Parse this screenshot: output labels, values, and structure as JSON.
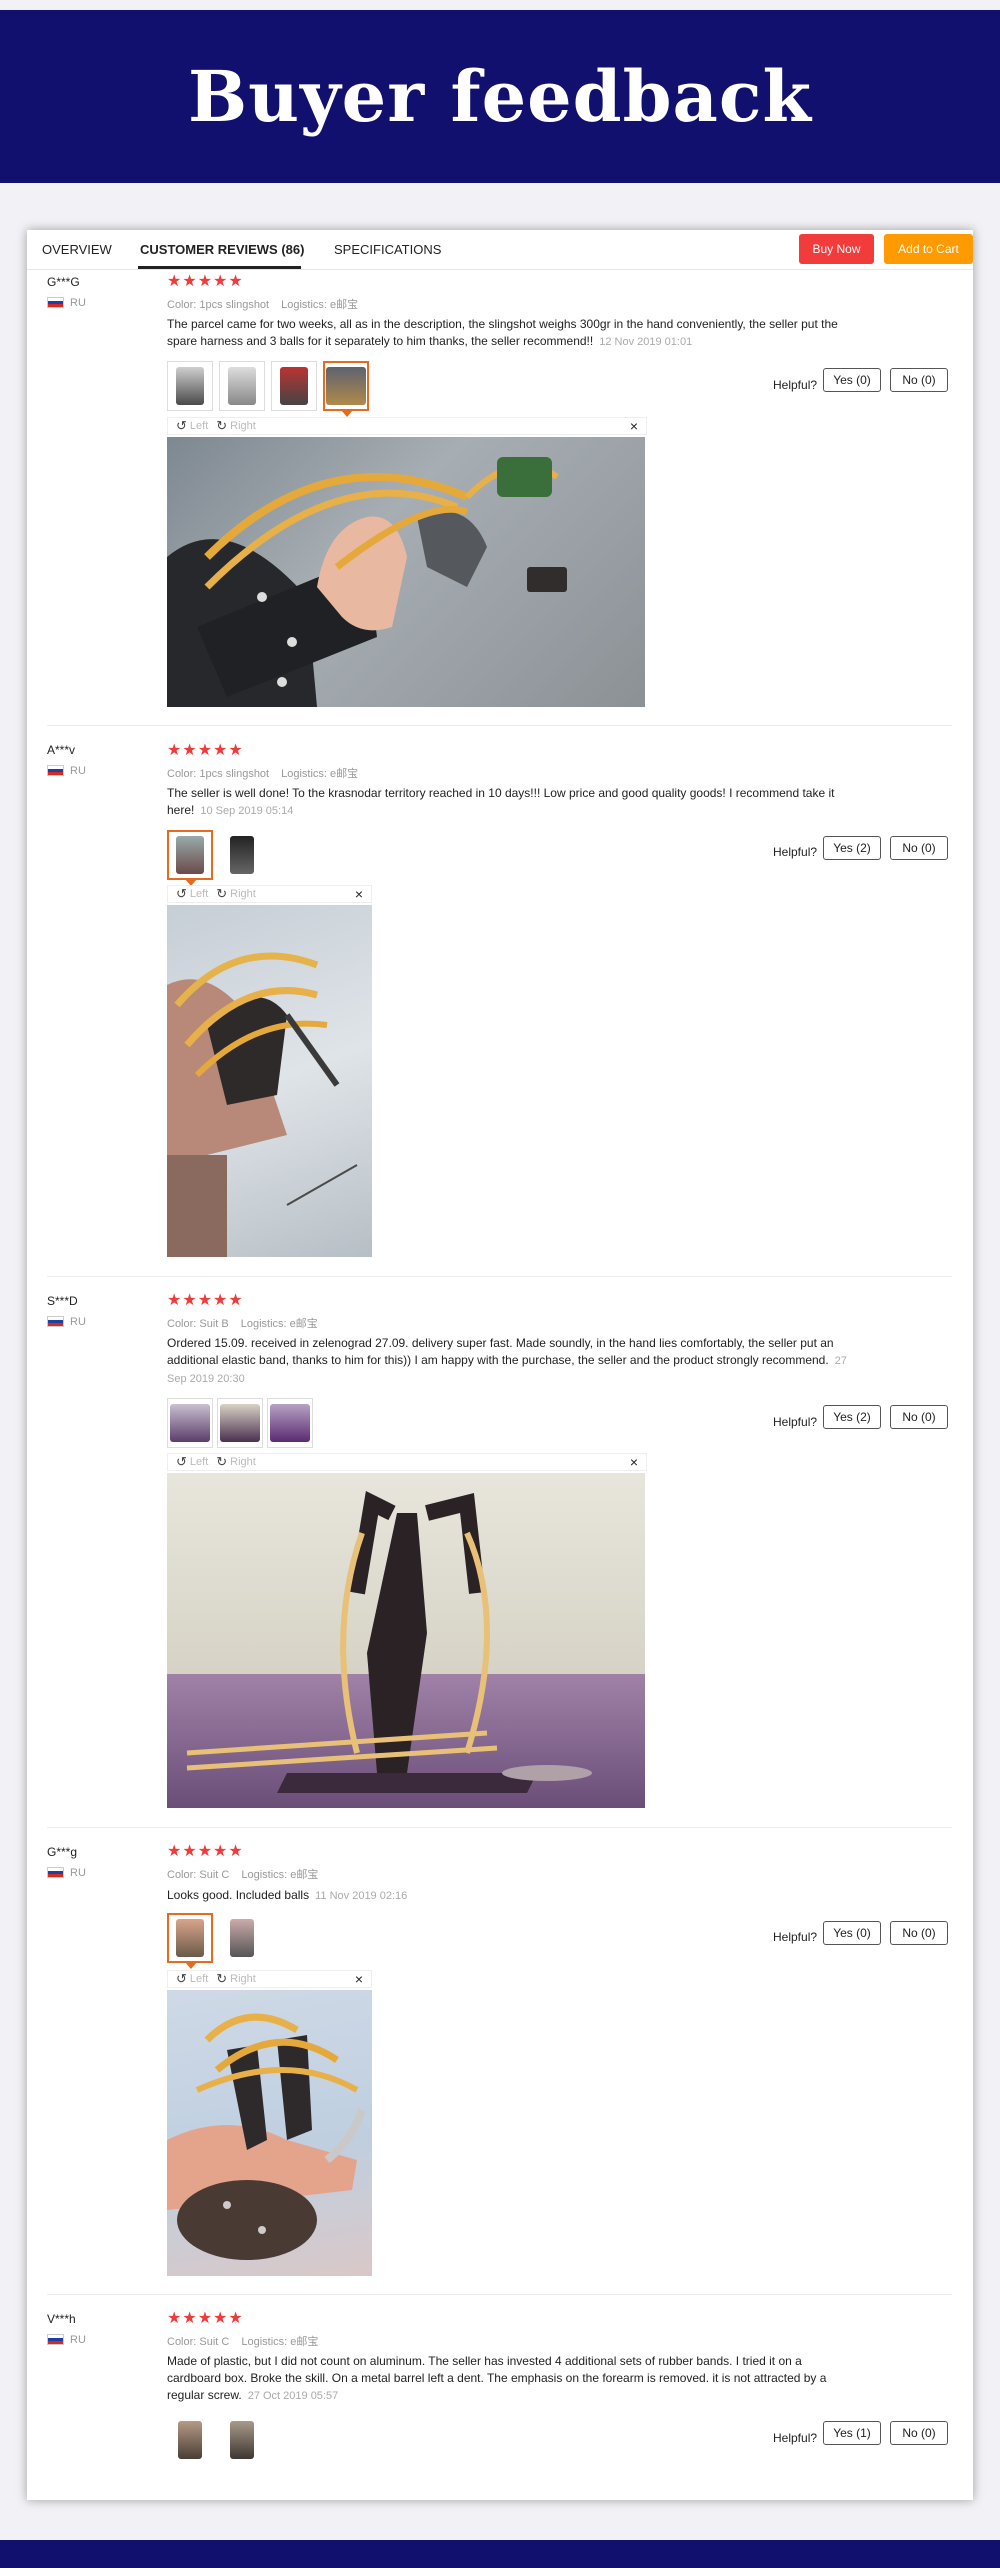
{
  "banner": {
    "title": "Buyer feedback"
  },
  "tabs": {
    "overview": "OVERVIEW",
    "reviews": "CUSTOMER REVIEWS (86)",
    "specs": "SPECIFICATIONS"
  },
  "actions": {
    "buy_now": "Buy Now",
    "add_to_cart": "Add to Cart"
  },
  "toolbar": {
    "left": "Left",
    "right": "Right",
    "close": "×"
  },
  "helpful_label": "Helpful?",
  "reviews": [
    {
      "user": "G***G",
      "country": "RU",
      "rating": 5,
      "color": "Color: 1pcs slingshot",
      "logistics": "Logistics: e邮宝",
      "text": "The parcel came for two weeks, all as in the description, the slingshot weighs 300gr in the hand conveniently, the seller put the spare harness and 3 balls for it separately to him thanks, the seller recommend!!",
      "date": "12 Nov 2019 01:01",
      "yes": "Yes (0)",
      "no": "No (0)"
    },
    {
      "user": "A***v",
      "country": "RU",
      "rating": 5,
      "color": "Color: 1pcs slingshot",
      "logistics": "Logistics: e邮宝",
      "text": "The seller is well done! To the krasnodar territory reached in 10 days!!! Low price and good quality goods! I recommend take it here!",
      "date": "10 Sep 2019 05:14",
      "yes": "Yes (2)",
      "no": "No (0)"
    },
    {
      "user": "S***D",
      "country": "RU",
      "rating": 5,
      "color": "Color: Suit B",
      "logistics": "Logistics: e邮宝",
      "text": "Ordered 15.09. received in zelenograd 27.09. delivery super fast. Made soundly, in the hand lies comfortably, the seller put an additional elastic band, thanks to him for this)) I am happy with the purchase, the seller and the product strongly recommend.",
      "date": "27 Sep 2019 20:30",
      "yes": "Yes (2)",
      "no": "No (0)"
    },
    {
      "user": "G***g",
      "country": "RU",
      "rating": 5,
      "color": "Color: Suit C",
      "logistics": "Logistics: e邮宝",
      "text": "Looks good. Included balls",
      "date": "11 Nov 2019 02:16",
      "yes": "Yes (0)",
      "no": "No (0)"
    },
    {
      "user": "V***h",
      "country": "RU",
      "rating": 5,
      "color": "Color: Suit C",
      "logistics": "Logistics: e邮宝",
      "text": "Made of plastic, but I did not count on aluminum. The seller has invested 4 additional sets of rubber bands. I tried it on a cardboard box. Broke the skill. On a metal barrel left a dent. The emphasis on the forearm is removed. it is not attracted by a regular screw.",
      "date": "27 Oct 2019 05:57",
      "yes": "Yes (1)",
      "no": "No (0)"
    }
  ],
  "colors": {
    "banner": "#12106e",
    "stars": "#ee3b3b",
    "buy_now": "#f23b3b",
    "add_to_cart": "#ff9a00",
    "selected_thumb": "#e56b1f"
  }
}
